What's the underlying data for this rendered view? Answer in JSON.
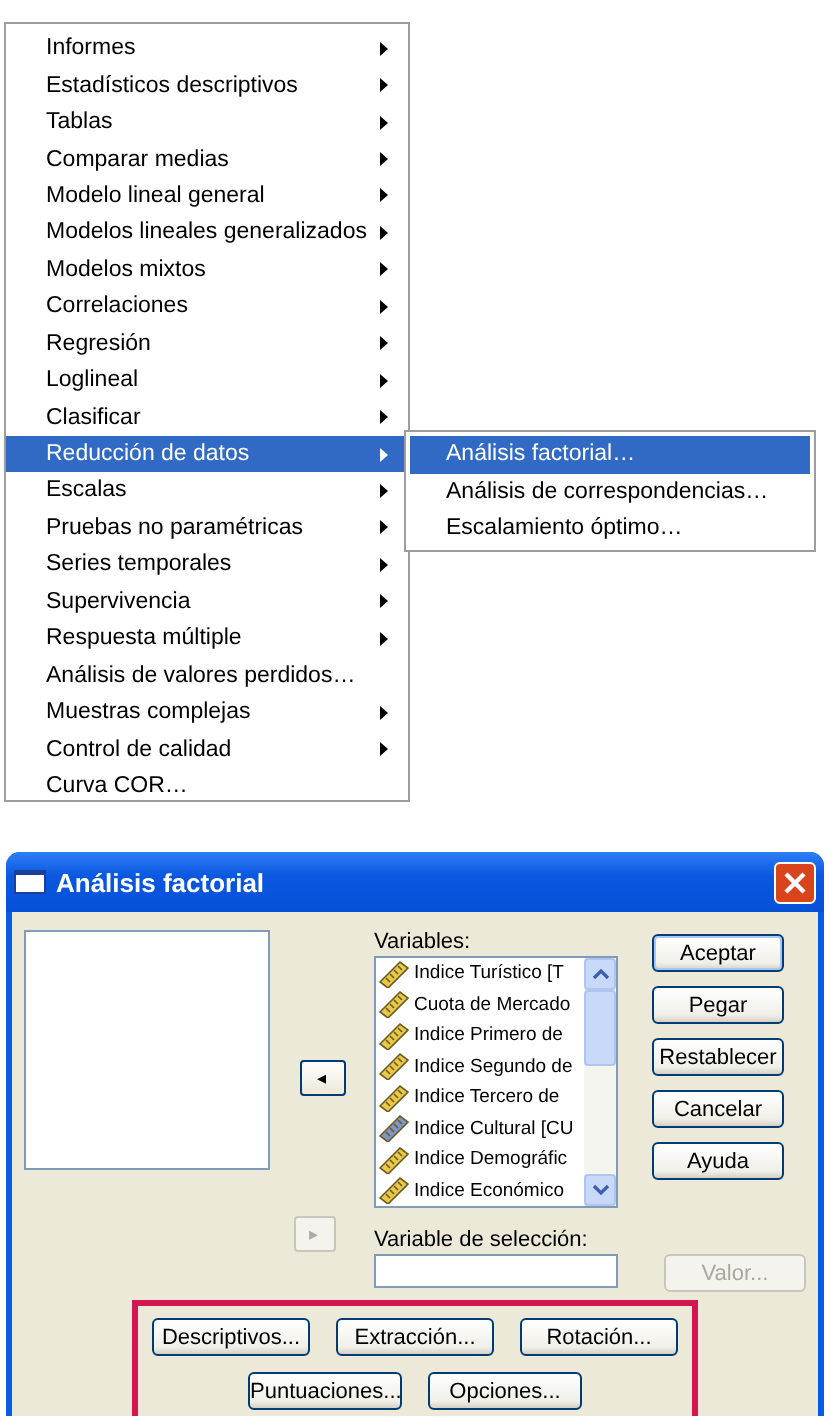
{
  "menu": {
    "items": [
      {
        "label": "Informes",
        "submenu": true,
        "selected": false
      },
      {
        "label": "Estadísticos descriptivos",
        "submenu": true,
        "selected": false
      },
      {
        "label": "Tablas",
        "submenu": true,
        "selected": false
      },
      {
        "label": "Comparar medias",
        "submenu": true,
        "selected": false
      },
      {
        "label": "Modelo lineal general",
        "submenu": true,
        "selected": false
      },
      {
        "label": "Modelos lineales generalizados",
        "submenu": true,
        "selected": false
      },
      {
        "label": "Modelos mixtos",
        "submenu": true,
        "selected": false
      },
      {
        "label": "Correlaciones",
        "submenu": true,
        "selected": false
      },
      {
        "label": "Regresión",
        "submenu": true,
        "selected": false
      },
      {
        "label": "Loglineal",
        "submenu": true,
        "selected": false
      },
      {
        "label": "Clasificar",
        "submenu": true,
        "selected": false
      },
      {
        "label": "Reducción de datos",
        "submenu": true,
        "selected": true
      },
      {
        "label": "Escalas",
        "submenu": true,
        "selected": false
      },
      {
        "label": "Pruebas no paramétricas",
        "submenu": true,
        "selected": false
      },
      {
        "label": "Series temporales",
        "submenu": true,
        "selected": false
      },
      {
        "label": "Supervivencia",
        "submenu": true,
        "selected": false
      },
      {
        "label": "Respuesta múltiple",
        "submenu": true,
        "selected": false
      },
      {
        "label": "Análisis de valores perdidos…",
        "submenu": false,
        "selected": false
      },
      {
        "label": "Muestras complejas",
        "submenu": true,
        "selected": false
      },
      {
        "label": "Control de calidad",
        "submenu": true,
        "selected": false
      },
      {
        "label": "Curva COR…",
        "submenu": false,
        "selected": false
      }
    ]
  },
  "submenu": {
    "items": [
      {
        "label": "Análisis factorial…",
        "selected": true
      },
      {
        "label": "Análisis de correspondencias…",
        "selected": false
      },
      {
        "label": "Escalamiento óptimo…",
        "selected": false
      }
    ]
  },
  "dialog": {
    "title": "Análisis factorial",
    "variables_label": "Variables:",
    "variables": [
      {
        "label": "Indice Turístico [T",
        "selected": false
      },
      {
        "label": "Cuota de Mercado",
        "selected": false
      },
      {
        "label": "Indice Primero de",
        "selected": false
      },
      {
        "label": "Indice Segundo de",
        "selected": false
      },
      {
        "label": "Indice Tercero de",
        "selected": false
      },
      {
        "label": "Indice Cultural [CU",
        "selected": true
      },
      {
        "label": "Indice Demográfic",
        "selected": false
      },
      {
        "label": "Indice Económico",
        "selected": false
      }
    ],
    "move_button": {
      "label": "◂",
      "disabled": false
    },
    "selection_move_button": {
      "label": "▸",
      "disabled": true
    },
    "selection_label": "Variable de selección:",
    "value_button": {
      "label": "Valor...",
      "disabled": true
    },
    "side_buttons": [
      "Aceptar",
      "Pegar",
      "Restablecer",
      "Cancelar",
      "Ayuda"
    ],
    "option_buttons": [
      [
        "Descriptivos...",
        "Extracción...",
        "Rotación..."
      ],
      [
        "Puntuaciones...",
        "Opciones..."
      ]
    ]
  }
}
